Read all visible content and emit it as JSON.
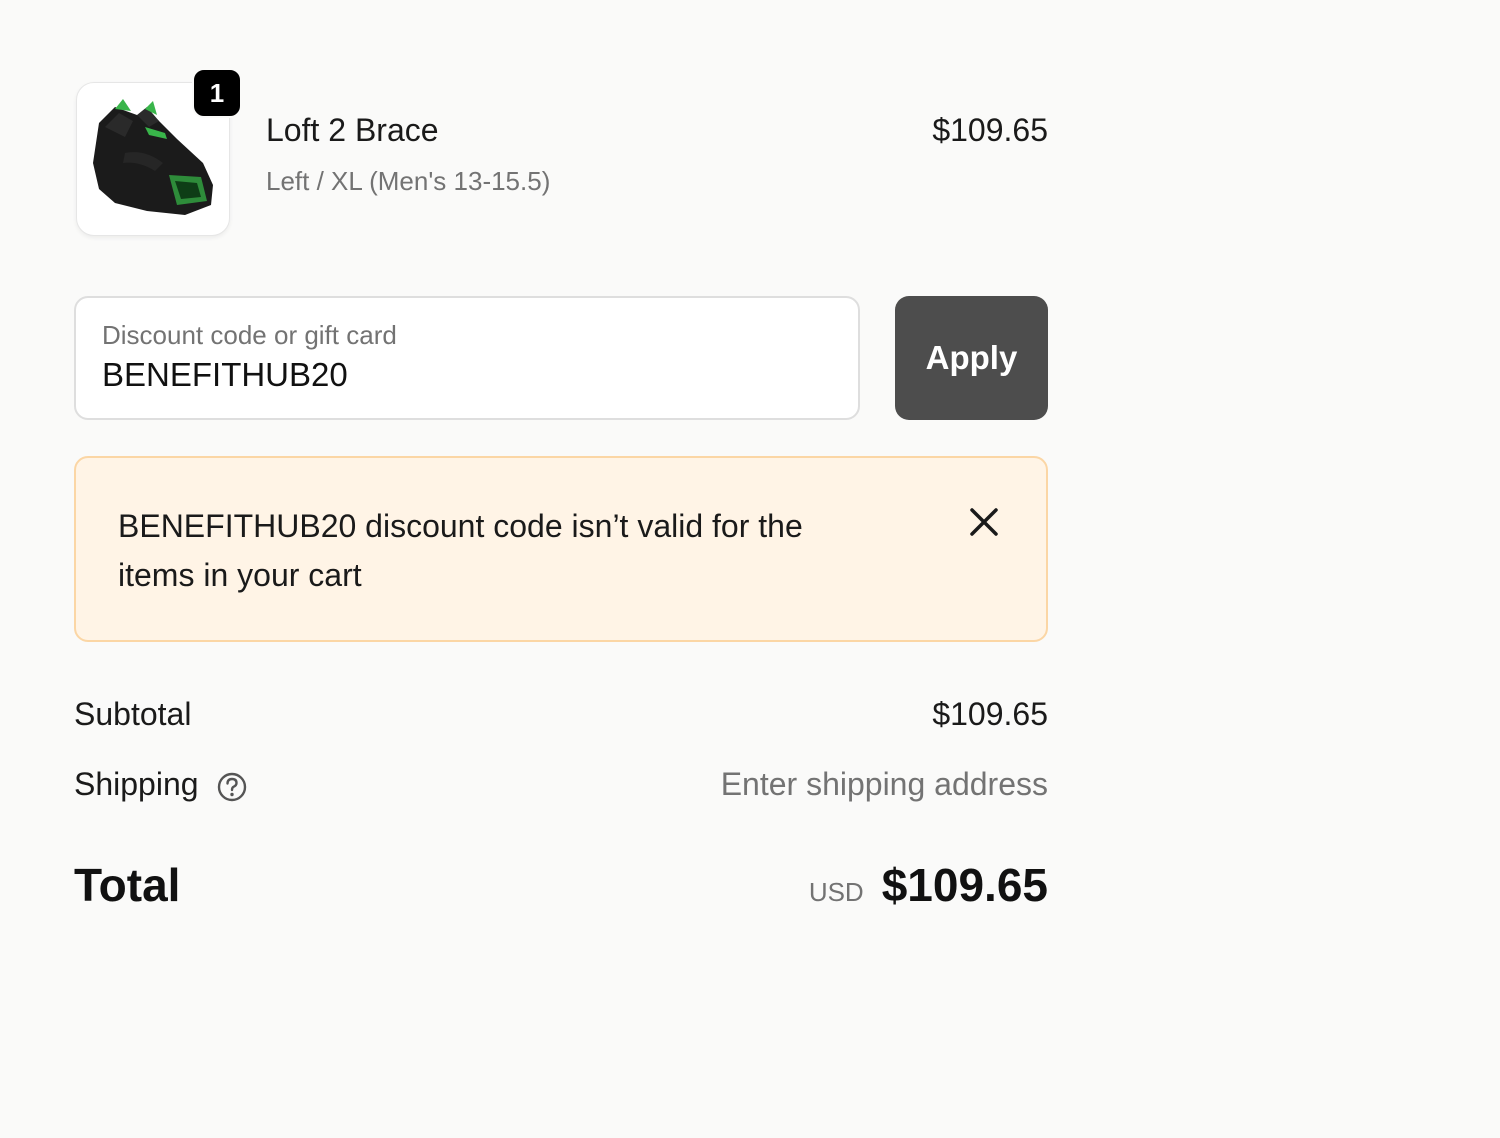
{
  "line_item": {
    "quantity": "1",
    "name": "Loft 2 Brace",
    "variant": "Left / XL (Men's 13-15.5)",
    "price": "$109.65",
    "image_icon": "brace-product-image"
  },
  "discount": {
    "label": "Discount code or gift card",
    "value": "BENEFITHUB20",
    "apply_label": "Apply"
  },
  "warning": {
    "code": "BENEFITHUB20",
    "message": " discount code isn’t valid for the items in your cart",
    "close_icon": "close-icon"
  },
  "summary": {
    "subtotal_label": "Subtotal",
    "subtotal_value": "$109.65",
    "shipping_label": "Shipping",
    "shipping_value": "Enter shipping address",
    "total_label": "Total",
    "currency": "USD",
    "total_value": "$109.65"
  },
  "colors": {
    "background": "#fafaf9",
    "apply_button": "#4d4d4d",
    "warning_bg": "#fff4e6",
    "warning_border": "#fbd6a5",
    "accent_green": "#39b54a"
  }
}
